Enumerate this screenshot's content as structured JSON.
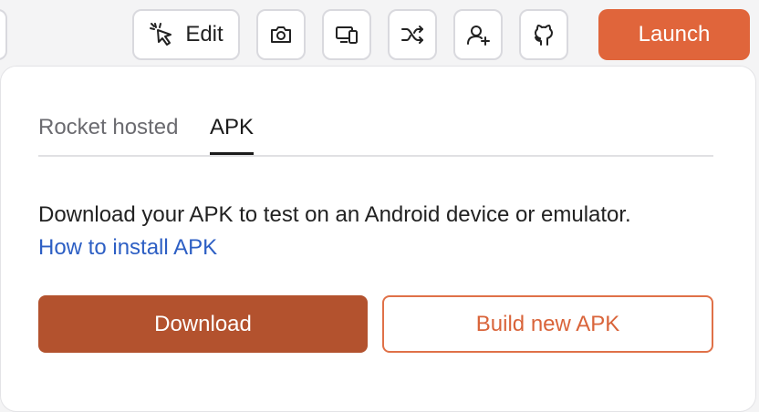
{
  "toolbar": {
    "edit_label": "Edit",
    "launch_label": "Launch",
    "icons": [
      "cursor-click-icon",
      "camera-icon",
      "devices-icon",
      "shuffle-icon",
      "user-plus-icon",
      "github-icon"
    ]
  },
  "panel": {
    "tabs": [
      {
        "label": "Rocket hosted",
        "active": false
      },
      {
        "label": "APK",
        "active": true
      }
    ],
    "description": "Download your APK to test on an Android device or emulator.",
    "help_link": "How to install APK",
    "download_label": "Download",
    "build_label": "Build new APK"
  },
  "colors": {
    "accent": "#e0653b",
    "download_bg": "#b3522e",
    "link": "#2d5fc4"
  }
}
